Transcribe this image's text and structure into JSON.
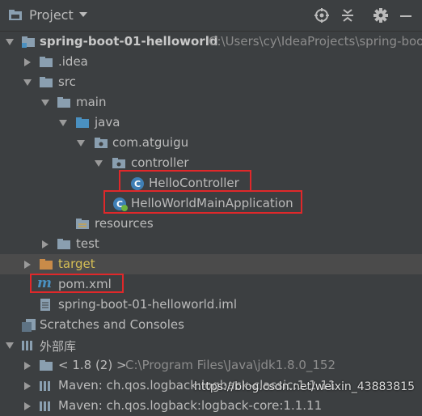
{
  "header": {
    "title": "Project",
    "caret_icon": "chevron-down-icon",
    "actions": [
      "locate-icon",
      "collapse-all-icon",
      "gear-icon",
      "minimize-icon"
    ]
  },
  "tree": {
    "project": {
      "name": "spring-boot-01-helloworld",
      "path": "C:\\Users\\cy\\IdeaProjects\\spring-boo"
    },
    "idea": ".idea",
    "src": "src",
    "main": "main",
    "java": "java",
    "package": "com.atguigu",
    "controller": "controller",
    "hello_controller": "HelloController",
    "main_app": "HelloWorldMainApplication",
    "resources": "resources",
    "test": "test",
    "target": "target",
    "pom": "pom.xml",
    "iml": "spring-boot-01-helloworld.iml",
    "scratches": "Scratches and Consoles",
    "external_libs": "外部库",
    "jdk": {
      "name": "< 1.8 (2) >",
      "path": "C:\\Program Files\\Java\\jdk1.8.0_152"
    },
    "maven1": "Maven: ch.qos.logback:logback-classic:1.1.11",
    "maven2": "Maven: ch.qos.logback:logback-core:1.1.11"
  },
  "watermark": "https://blog.csdn.net/weixin_43883815",
  "colors": {
    "background": "#3c3f41",
    "selection": "#4b4b4b",
    "highlight": "#e0282a",
    "folder": "#8a9fb0",
    "source_folder": "#4a90c0",
    "excluded_folder": "#c98b49"
  }
}
